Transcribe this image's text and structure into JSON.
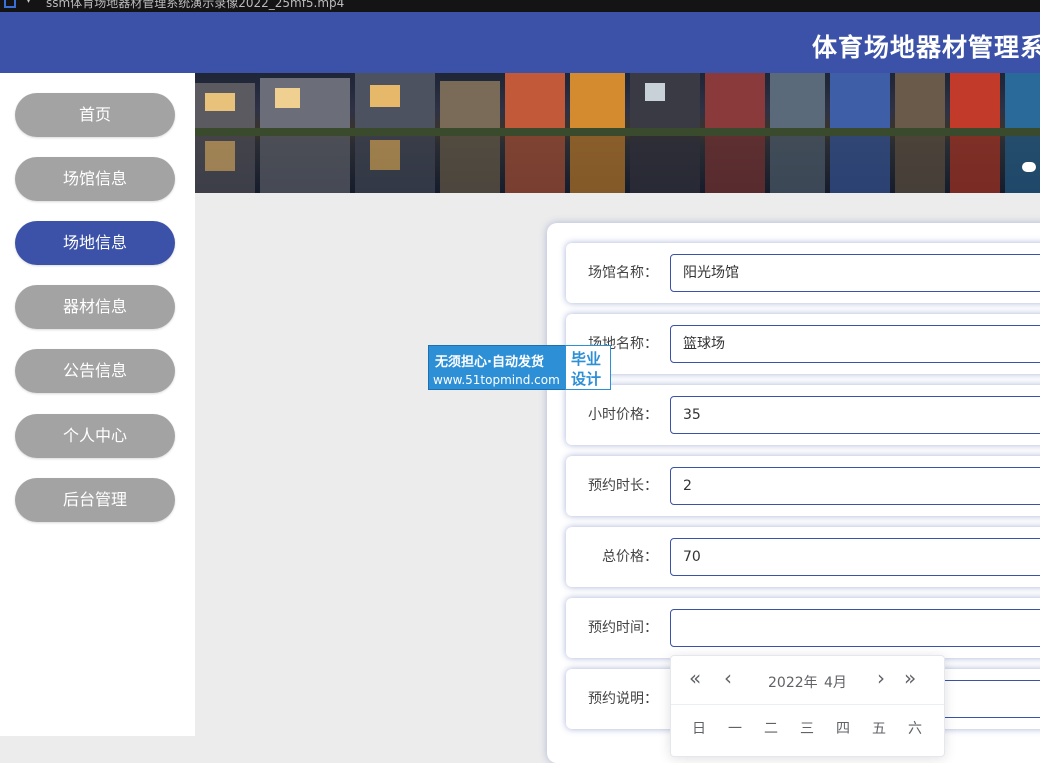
{
  "window": {
    "title": "ssm体育场地器材管理系统演示录像2022_25mf5.mp4"
  },
  "header": {
    "title": "体育场地器材管理系"
  },
  "sidebar": {
    "items": [
      {
        "label": "首页"
      },
      {
        "label": "场馆信息"
      },
      {
        "label": "场地信息"
      },
      {
        "label": "器材信息"
      },
      {
        "label": "公告信息"
      },
      {
        "label": "个人中心"
      },
      {
        "label": "后台管理"
      }
    ],
    "active_index": 2
  },
  "form": {
    "rows": [
      {
        "label": "场馆名称：",
        "value": "阳光场馆"
      },
      {
        "label": "场地名称：",
        "value": "篮球场"
      },
      {
        "label": "小时价格：",
        "value": "35"
      },
      {
        "label": "预约时长：",
        "value": "2"
      },
      {
        "label": "总价格：",
        "value": "70"
      },
      {
        "label": "预约时间：",
        "value": ""
      },
      {
        "label": "预约说明：",
        "value": ""
      }
    ]
  },
  "datepicker": {
    "year": "2022年",
    "month": "4月",
    "prev_year": "«",
    "prev_month": "‹",
    "next_month": "›",
    "next_year": "»",
    "weekdays": [
      "日",
      "一",
      "二",
      "三",
      "四",
      "五",
      "六"
    ]
  },
  "watermark": {
    "line1": "无须担心·自动发货",
    "line2": "www.51topmind.com",
    "right1": "毕业",
    "right2": "设计"
  },
  "colors": {
    "accent": "#3b52a8",
    "nav_inactive": "#a3a3a3",
    "background": "#ececec"
  }
}
